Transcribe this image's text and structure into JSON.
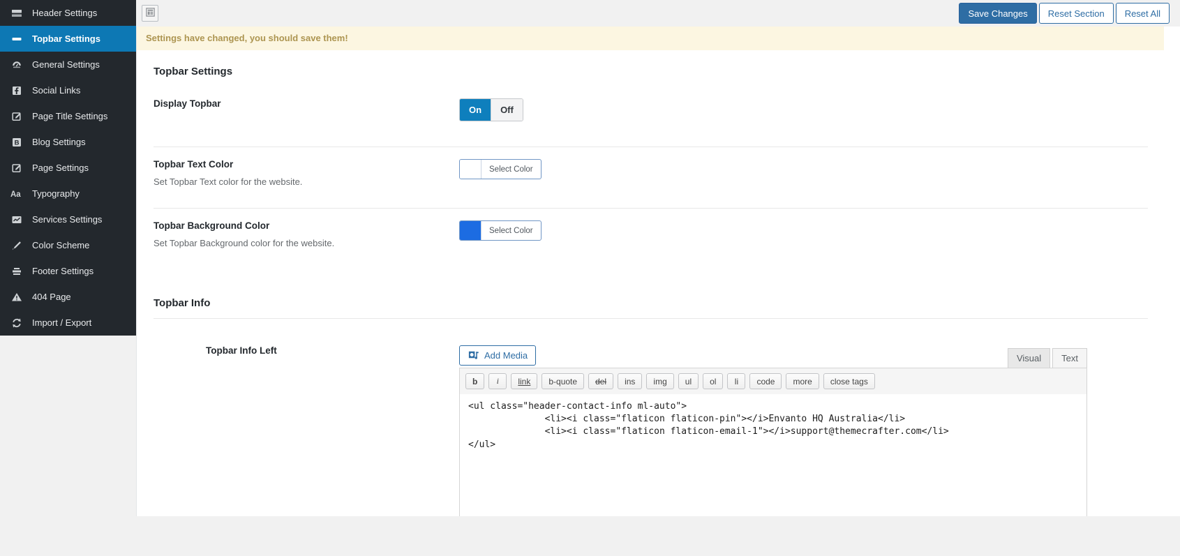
{
  "colors": {
    "sidebar_bg": "#23282d",
    "sidebar_active_bg": "#0d78b4",
    "primary_button_blue": "#2e6da4",
    "toggle_on_blue": "#0e7fbd",
    "notice_bg": "#fcf6e1",
    "notice_text": "#ad9551",
    "topbar_text_color_swatch": "#ffffff",
    "topbar_background_color_swatch": "#1c6ce2"
  },
  "sidebar": {
    "items": [
      {
        "label": "Header Settings",
        "icon": "header-layout-icon",
        "active": false
      },
      {
        "label": "Topbar Settings",
        "icon": "topbar-bar-icon",
        "active": true
      },
      {
        "label": "General Settings",
        "icon": "dashboard-gauge-icon",
        "active": false
      },
      {
        "label": "Social Links",
        "icon": "facebook-icon",
        "active": false
      },
      {
        "label": "Page Title Settings",
        "icon": "edit-page-icon",
        "active": false
      },
      {
        "label": "Blog Settings",
        "icon": "blog-icon",
        "active": false
      },
      {
        "label": "Page Settings",
        "icon": "edit-page-icon",
        "active": false
      },
      {
        "label": "Typography",
        "icon": "typography-aa-icon",
        "active": false
      },
      {
        "label": "Services Settings",
        "icon": "chart-icon",
        "active": false
      },
      {
        "label": "Color Scheme",
        "icon": "brush-icon",
        "active": false
      },
      {
        "label": "Footer Settings",
        "icon": "footer-lines-icon",
        "active": false
      },
      {
        "label": "404 Page",
        "icon": "warning-triangle-icon",
        "active": false
      },
      {
        "label": "Import / Export",
        "icon": "sync-arrows-icon",
        "active": false
      }
    ]
  },
  "header_bar": {
    "save_button": "Save Changes",
    "reset_section_button": "Reset Section",
    "reset_all_button": "Reset All"
  },
  "notice": {
    "message": "Settings have changed, you should save them!"
  },
  "page": {
    "section_title": "Topbar Settings",
    "fields": {
      "display_topbar": {
        "label": "Display Topbar",
        "on": "On",
        "off": "Off",
        "value": "On"
      },
      "topbar_text_color": {
        "label": "Topbar Text Color",
        "description": "Set Topbar Text color for the website.",
        "button": "Select Color",
        "swatch": "#ffffff"
      },
      "topbar_background_color": {
        "label": "Topbar Background Color",
        "description": "Set Topbar Background color for the website.",
        "button": "Select Color",
        "swatch": "#1c6ce2"
      }
    },
    "subsection_title": "Topbar Info",
    "topbar_info_left": {
      "label": "Topbar Info Left",
      "add_media_button": "Add Media",
      "tabs": {
        "visual": "Visual",
        "text": "Text",
        "active_tab": "Text"
      },
      "quicktags": [
        "b",
        "i",
        "link",
        "b-quote",
        "del",
        "ins",
        "img",
        "ul",
        "ol",
        "li",
        "code",
        "more",
        "close tags"
      ],
      "editor_content": "<ul class=\"header-contact-info ml-auto\">\n\t\t<li><i class=\"flaticon flaticon-pin\"></i>Envanto HQ Australia</li>\n\t\t<li><i class=\"flaticon flaticon-email-1\"></i>support@themecrafter.com</li>\n</ul>"
    }
  }
}
